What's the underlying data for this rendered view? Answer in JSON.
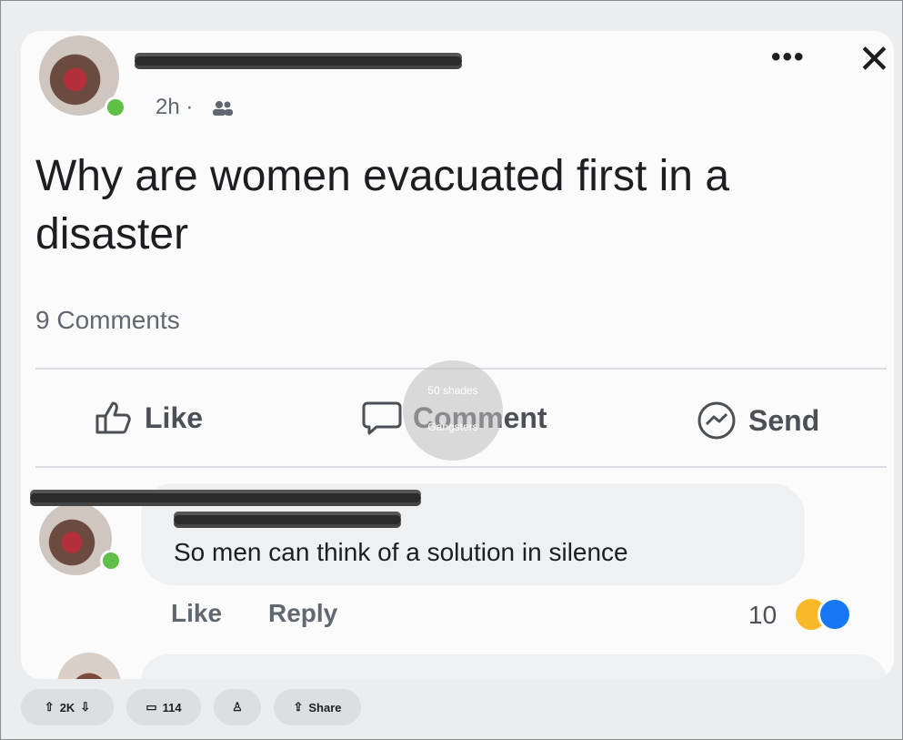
{
  "post": {
    "time": "2h ·",
    "text": "Why are women evacuated first in a disaster",
    "comments_count": "9 Comments"
  },
  "actions": {
    "like": "Like",
    "comment": "Comment",
    "send": "Send"
  },
  "watermark": {
    "line1": "50 shades",
    "line2": "Gangsters"
  },
  "comment": {
    "text": "So men can think of a solution in silence",
    "like": "Like",
    "reply": "Reply",
    "reactions": "10"
  },
  "bottom_bar": {
    "upvotes": "2K",
    "comments": "114",
    "share": "Share"
  },
  "icons": {
    "more": "more-icon",
    "close": "close-icon",
    "audience": "friends-icon",
    "like": "thumbs-up-icon",
    "comment": "comment-bubble-icon",
    "send": "messenger-icon"
  },
  "colors": {
    "online": "#5fbf46",
    "like_reaction": "#1877f2",
    "haha_reaction": "#f7b928"
  }
}
